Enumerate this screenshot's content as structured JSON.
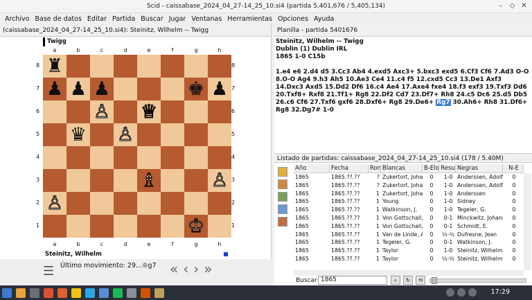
{
  "window": {
    "title": "Scid - caissabase_2024_04_27-14_25_10.si4 (partida 5,401,676 / 5,405,134)"
  },
  "menu": [
    "Archivo",
    "Base de datos",
    "Editar",
    "Partida",
    "Buscar",
    "Jugar",
    "Ventanas",
    "Herramientas",
    "Opciones",
    "Ayuda"
  ],
  "board_tab": "(caissabase_2024_04_27-14_25_10.si4): Steinitz, Wilhelm -- Twigg",
  "white_player": "Twigg",
  "black_player": "Steinitz, Wilhelm",
  "last_move": "Último movimiento: 29...♔g7",
  "files": [
    "a",
    "b",
    "c",
    "d",
    "e",
    "f",
    "g",
    "h"
  ],
  "ranks": [
    "8",
    "7",
    "6",
    "5",
    "4",
    "3",
    "2",
    "1"
  ],
  "pieces": {
    "a8": "♜",
    "a7": "♟",
    "b7": "♟",
    "c7": "♟",
    "h7": "♟",
    "g7": "♚",
    "c6": "♙",
    "e6": "♕",
    "b5": "♛",
    "d5": "♙",
    "e3": "♗",
    "h3": "♙",
    "a2": "♙",
    "g1": "♔"
  },
  "notation_tab": "Planilla - partida 5401676",
  "notation": {
    "hdr1": "Steinitz, Wilhelm  --  Twigg",
    "hdr2": "Dublin (1)  Dublin IRL",
    "hdr3": "1865  1-0  C15b",
    "moves_a": "1.e4 e6 2.d4 d5 3.Cc3 Ab4 4.exd5 Axc3+ 5.bxc3 exd5 6.Cf3 Cf6 7.Ad3 O-O 8.O-O Ag4 9.h3 Ah5 10.Ae3 Ce4 11.c4 f5 12.cxd5 Cc3 13.De1 Axf3 14.Dxc3 Axd5 15.Dd2 Df6 16.c4 Ae4 17.Axe4 fxe4 18.f3 exf3 19.Txf3 Dd6 20.Txf8+ Rxf8 21.Tf1+ Rg8 22.Df2 Cd7 23.Df7+ Rh8 24.c5 Dc6 25.d5 Db5 26.c6 Cf6 27.Txf6 gxf6 28.Dxf6+ Rg8 29.De6+ ",
    "move_hl": "Rg7",
    "moves_b": " 30.Ah6+ Rh8 31.Df6+ Rg8 32.Dg7# 1-0"
  },
  "list_tab": "Listado de partidas: caissabase_2024_04_27-14_25_10.si4 (178 / 5.40M)",
  "table": {
    "headers": [
      "Año",
      "Fecha",
      "Ron",
      "Blancas",
      "B-Elo",
      "Resu",
      "Negras",
      "N-E"
    ],
    "rows": [
      [
        "1865",
        "1865.??.??",
        "?",
        "Zukertort, Johanne",
        "0",
        "1-0",
        "Anderssen, Adolf",
        "0"
      ],
      [
        "1865",
        "1865.??.??",
        "?",
        "Zukertort, Johanne",
        "0",
        "1-0",
        "Anderssen, Adolf",
        "0"
      ],
      [
        "1865",
        "1865.??.??",
        "1",
        "Zukertort, Johanne",
        "0",
        "1-0",
        "Anderssen",
        "0"
      ],
      [
        "1865",
        "1865.??.??",
        "1",
        "Young",
        "0",
        "1-0",
        "Sidney",
        "0"
      ],
      [
        "1865",
        "1865.??.??",
        "1",
        "Watkinson, J.",
        "0",
        "1-0",
        "Tegeler, G.",
        "0"
      ],
      [
        "1865",
        "1865.??.??",
        "1",
        "Von Gottschall, Ru",
        "0",
        "0-1",
        "Minckwitz, Johanne",
        "0"
      ],
      [
        "1865",
        "1865.??.??",
        "1",
        "Von Gottschall, Ru",
        "0",
        "0-1",
        "Schmidt, E.",
        "0"
      ],
      [
        "1865",
        "1865.??.??",
        "1",
        "Van de Linde, A.",
        "0",
        "½-½",
        "Dufresne, Jean",
        "0"
      ],
      [
        "1865",
        "1865.??.??",
        "1",
        "Tegeler, G.",
        "0",
        "0-1",
        "Watkinson, J.",
        "0"
      ],
      [
        "1865",
        "1865.??.??",
        "1",
        "Taylor",
        "0",
        "1-0",
        "Steinitz, Wilhelm",
        "0"
      ],
      [
        "1865",
        "1865.??.??",
        "1",
        "Taylor",
        "0",
        "½-½",
        "Steinitz, Wilhelm",
        "0"
      ]
    ]
  },
  "search": {
    "label": "Buscar",
    "value": "1865"
  },
  "clock": "17:29"
}
